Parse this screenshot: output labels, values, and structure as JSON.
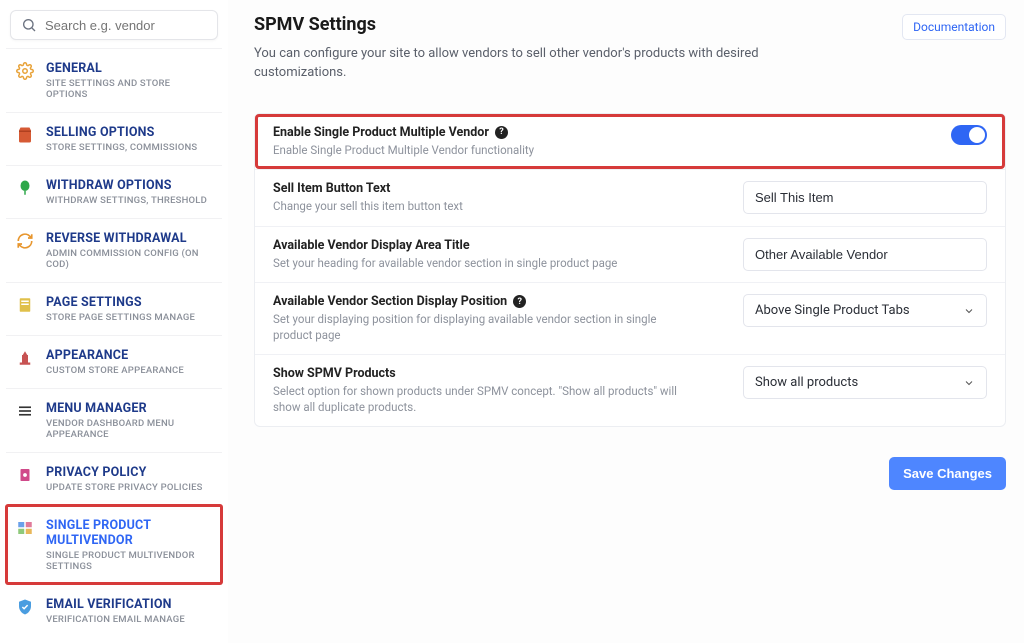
{
  "search": {
    "placeholder": "Search e.g. vendor"
  },
  "sidebar": {
    "items": [
      {
        "title": "GENERAL",
        "sub": "SITE SETTINGS AND STORE OPTIONS"
      },
      {
        "title": "SELLING OPTIONS",
        "sub": "STORE SETTINGS, COMMISSIONS"
      },
      {
        "title": "WITHDRAW OPTIONS",
        "sub": "WITHDRAW SETTINGS, THRESHOLD"
      },
      {
        "title": "REVERSE WITHDRAWAL",
        "sub": "ADMIN COMMISSION CONFIG (ON COD)"
      },
      {
        "title": "PAGE SETTINGS",
        "sub": "STORE PAGE SETTINGS MANAGE"
      },
      {
        "title": "APPEARANCE",
        "sub": "CUSTOM STORE APPEARANCE"
      },
      {
        "title": "MENU MANAGER",
        "sub": "VENDOR DASHBOARD MENU APPEARANCE"
      },
      {
        "title": "PRIVACY POLICY",
        "sub": "UPDATE STORE PRIVACY POLICIES"
      },
      {
        "title": "SINGLE PRODUCT MULTIVENDOR",
        "sub": "SINGLE PRODUCT MULTIVENDOR SETTINGS"
      },
      {
        "title": "EMAIL VERIFICATION",
        "sub": "VERIFICATION EMAIL MANAGE"
      }
    ]
  },
  "page": {
    "title": "SPMV Settings",
    "desc": "You can configure your site to allow vendors to sell other vendor's products with desired customizations.",
    "doc_link": "Documentation"
  },
  "rows": {
    "enable": {
      "label": "Enable Single Product Multiple Vendor",
      "desc": "Enable Single Product Multiple Vendor functionality",
      "help": "?"
    },
    "button_text": {
      "label": "Sell Item Button Text",
      "desc": "Change your sell this item button text",
      "value": "Sell This Item"
    },
    "area_title": {
      "label": "Available Vendor Display Area Title",
      "desc": "Set your heading for available vendor section in single product page",
      "value": "Other Available Vendor"
    },
    "position": {
      "label": "Available Vendor Section Display Position",
      "desc": "Set your displaying position for displaying available vendor section in single product page",
      "value": "Above Single Product Tabs",
      "help": "?"
    },
    "show": {
      "label": "Show SPMV Products",
      "desc": "Select option for shown products under SPMV concept. \"Show all products\" will show all duplicate products.",
      "value": "Show all products"
    }
  },
  "actions": {
    "save": "Save Changes"
  }
}
